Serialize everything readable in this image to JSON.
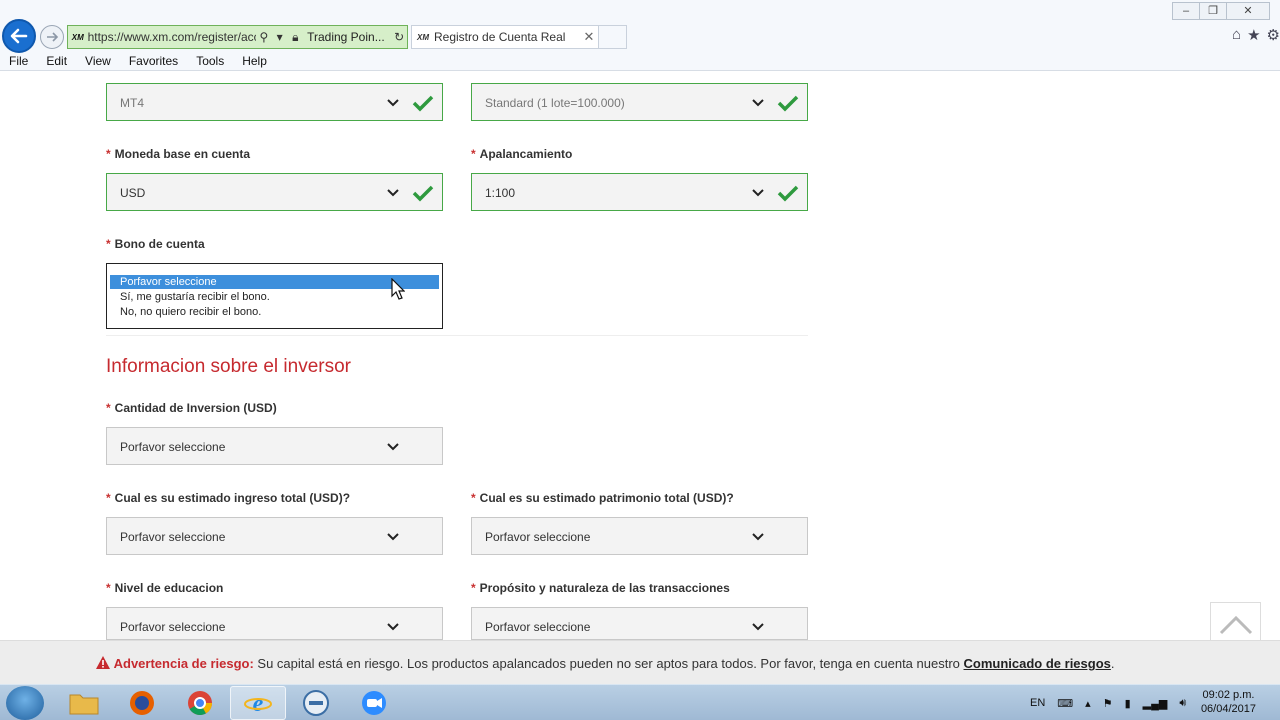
{
  "browser": {
    "url": "https://www.xm.com/register/acc",
    "url_domain": "xm.com",
    "site_identity": "Trading Poin...",
    "tab_title": "Registro de Cuenta Real",
    "favicon_text": "XM",
    "menu": [
      "File",
      "Edit",
      "View",
      "Favorites",
      "Tools",
      "Help"
    ]
  },
  "form": {
    "platform_value": "MT4",
    "account_type_value": "Standard (1 lote=100.000)",
    "currency_label": "Moneda base en cuenta",
    "currency_value": "USD",
    "leverage_label": "Apalancamiento",
    "leverage_value": "1:100",
    "bonus_label": "Bono de cuenta",
    "bonus_options": [
      "Porfavor seleccione",
      "Sí, me gustaría recibir el bono.",
      "No, no quiero recibir el bono."
    ],
    "bonus_selected_index": 0
  },
  "investor": {
    "title": "Informacion sobre el inversor",
    "amount_label": "Cantidad de Inversion (USD)",
    "income_label": "Cual es su estimado ingreso total (USD)?",
    "wealth_label": "Cual es su estimado patrimonio total (USD)?",
    "education_label": "Nivel de educacion",
    "purpose_label": "Propósito y naturaleza de las transacciones",
    "placeholder": "Porfavor seleccione"
  },
  "risk": {
    "warning_label": "Advertencia de riesgo:",
    "text": "Su capital está en riesgo. Los productos apalancados pueden no ser aptos para todos. Por favor, tenga en cuenta nuestro",
    "link": "Comunicado de riesgos",
    "end": "."
  },
  "taskbar": {
    "language": "EN",
    "time": "09:02 p.m.",
    "date": "06/04/2017",
    "apps": [
      "folder-icon",
      "firefox-icon",
      "chrome-icon",
      "ie-icon",
      "dell-icon",
      "zoom-icon"
    ]
  },
  "colors": {
    "accent_red": "#c62a2f",
    "valid_green": "#47a847",
    "selected_blue": "#3d8fdc"
  }
}
